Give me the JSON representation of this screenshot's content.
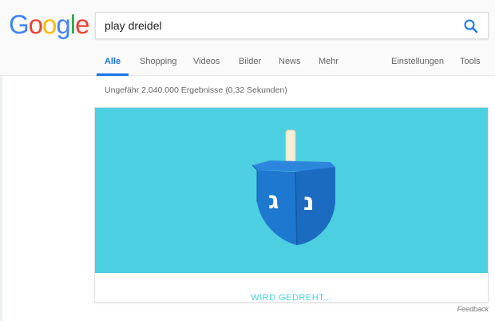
{
  "logo": {
    "letters": [
      {
        "char": "G",
        "color": "#4285F4"
      },
      {
        "char": "o",
        "color": "#EA4335"
      },
      {
        "char": "o",
        "color": "#FBBC05"
      },
      {
        "char": "g",
        "color": "#4285F4"
      },
      {
        "char": "l",
        "color": "#34A853"
      },
      {
        "char": "e",
        "color": "#EA4335"
      }
    ]
  },
  "search": {
    "query": "play dreidel",
    "button_icon": "search-icon"
  },
  "tabs": {
    "all": "Alle",
    "shopping": "Shopping",
    "videos": "Videos",
    "images": "Bilder",
    "news": "News",
    "more": "Mehr",
    "settings": "Einstellungen",
    "tools": "Tools"
  },
  "results": {
    "stats": "Ungefähr 2.040.000 Ergebnisse (0,32 Sekunden)"
  },
  "game": {
    "status": "WIRD GEDREHT...",
    "dreidel_letters": {
      "left": "ג",
      "right": "נ"
    },
    "colors": {
      "background": "#4ccfe0",
      "dreidel_body": "#1e78d0",
      "dreidel_dark": "#1660b0",
      "handle": "#f3eed5",
      "accent": "#1a73e8"
    }
  },
  "footer": {
    "feedback": "Feedback"
  }
}
